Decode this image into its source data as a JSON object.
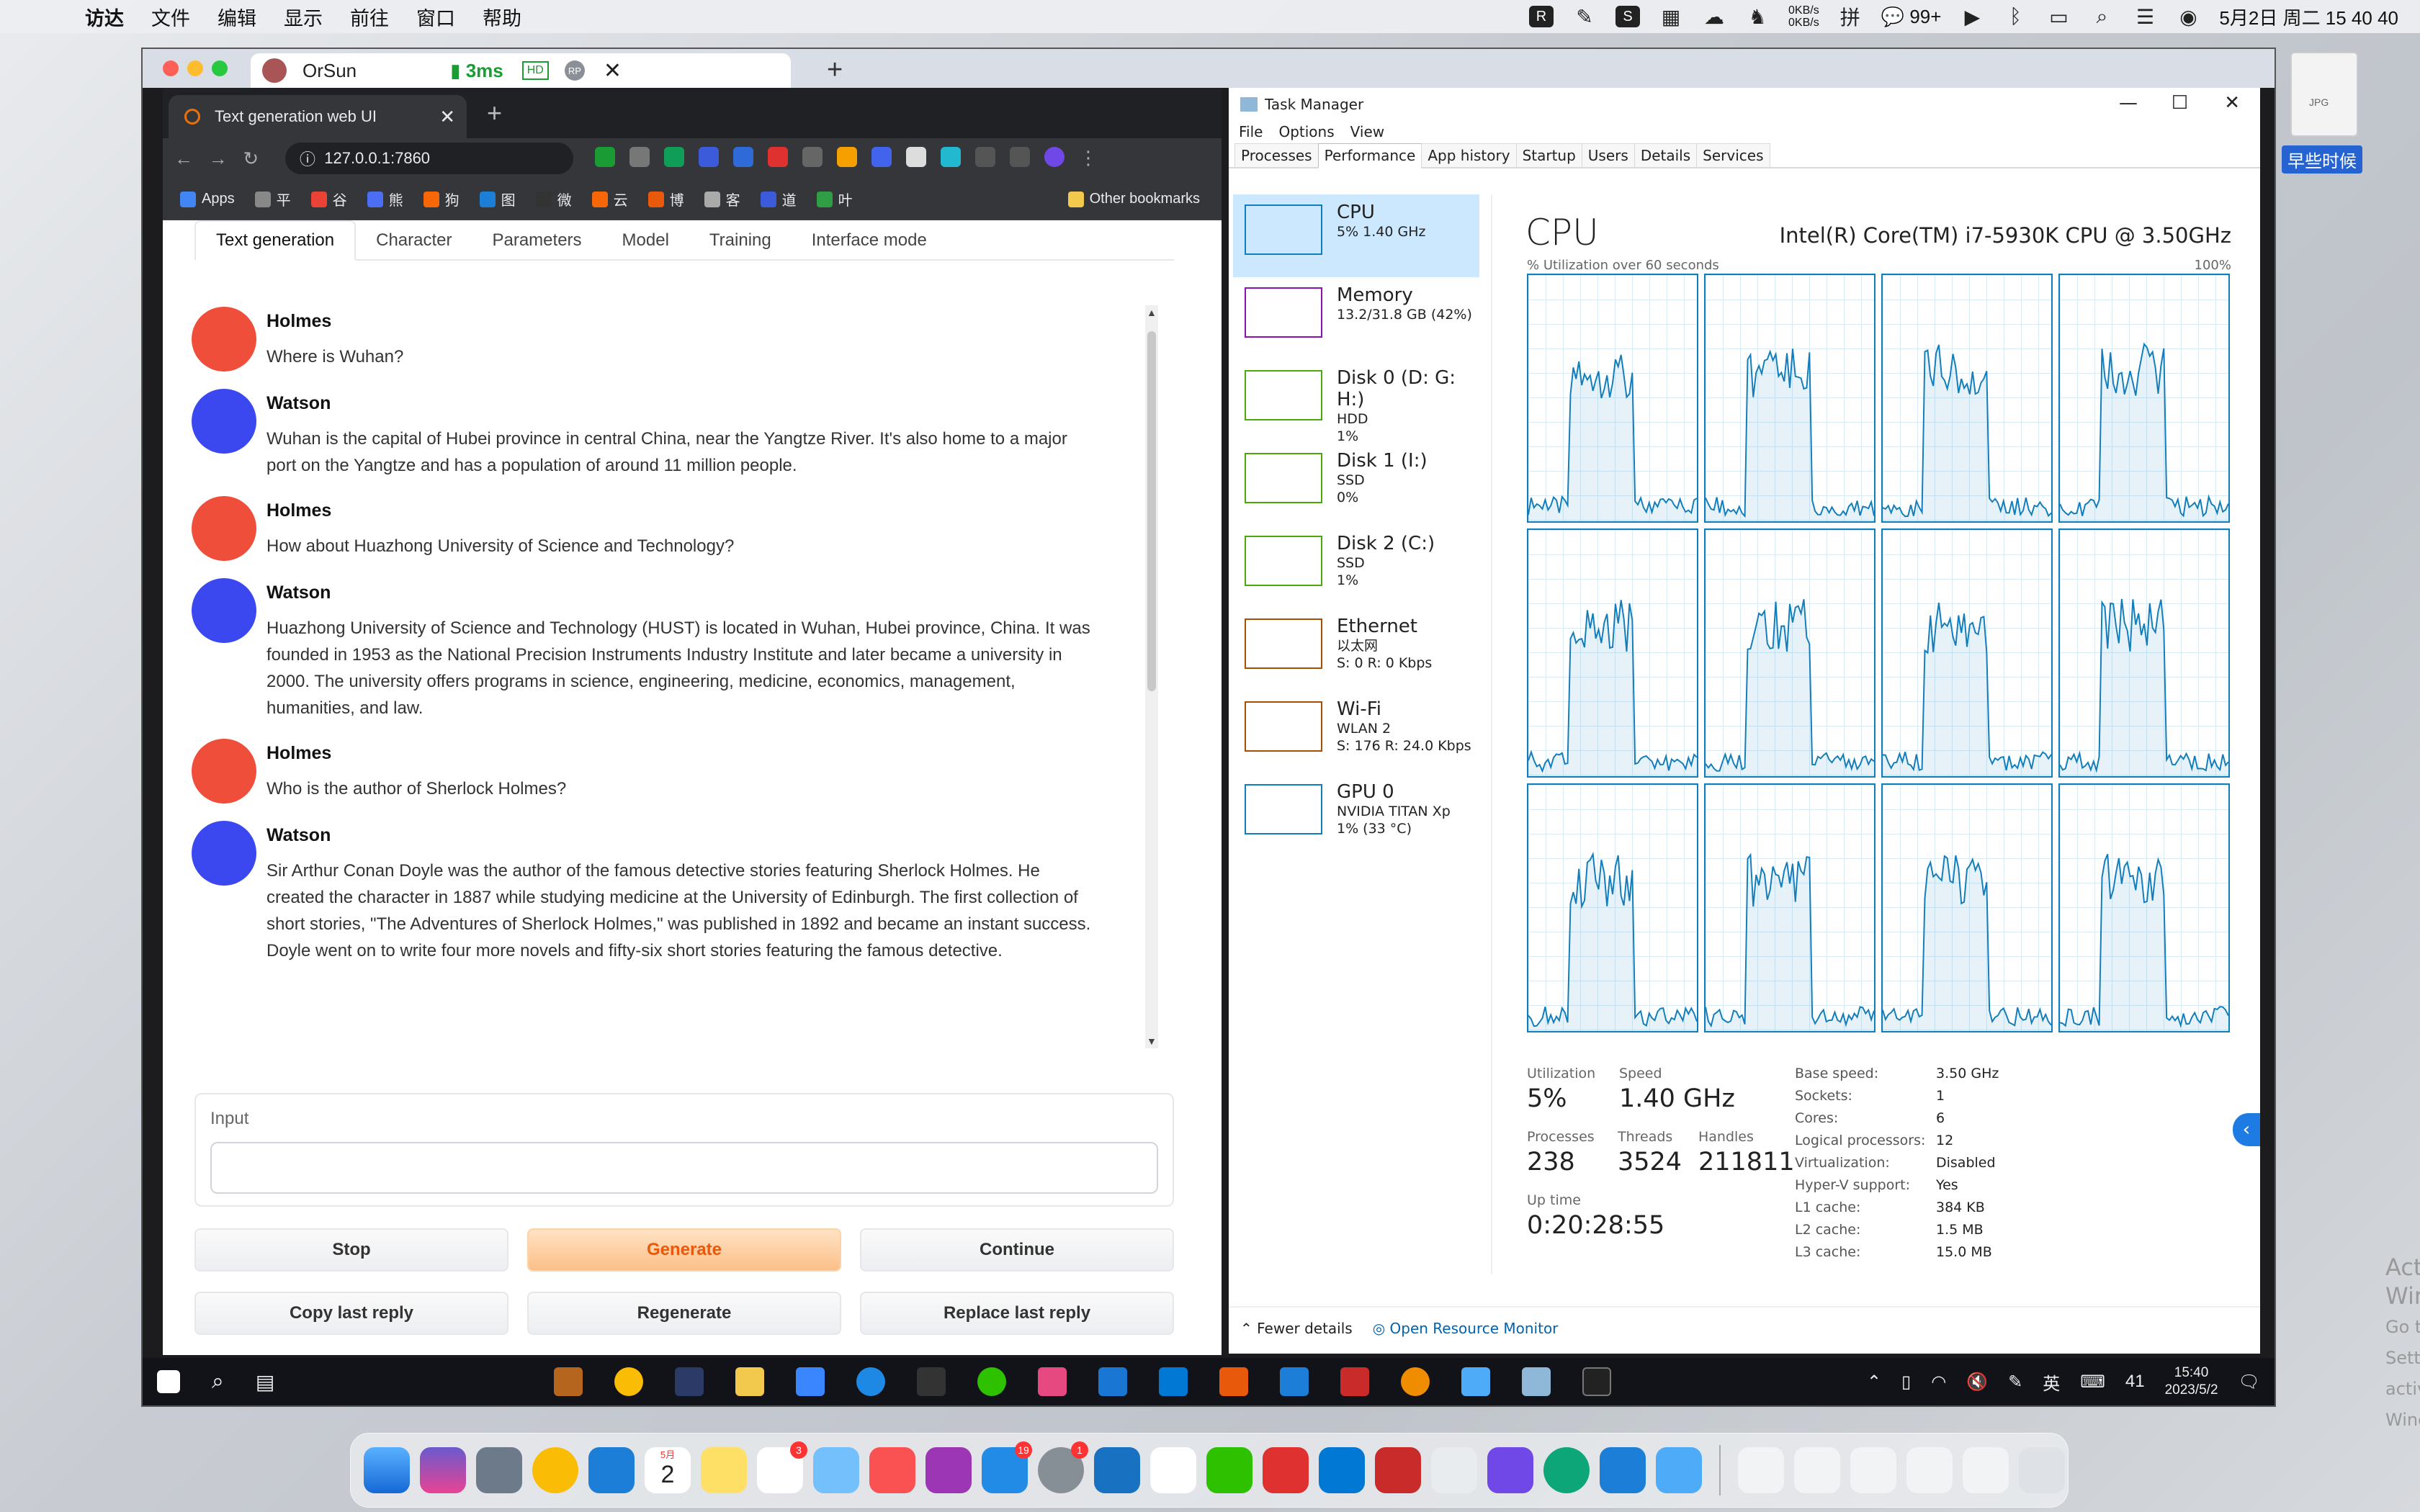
{
  "menubar": {
    "app": "访达",
    "items": [
      "文件",
      "编辑",
      "显示",
      "前往",
      "窗口",
      "帮助"
    ],
    "net_up": "0KB/s",
    "net_down": "0KB/s",
    "wechat_count": "99+",
    "datetime": "5月2日 周二  15 40 40"
  },
  "remote": {
    "tab_title": "OrSun",
    "latency": "3ms",
    "hd_badge": "HD",
    "rp_badge": "RP"
  },
  "browser": {
    "tab_title": "Text generation web UI",
    "url": "127.0.0.1:7860",
    "bookmarks": [
      "Apps",
      "平",
      "谷",
      "熊",
      "狗",
      "图",
      "微",
      "云",
      "博",
      "客",
      "道",
      "叶"
    ],
    "other_bookmarks": "Other bookmarks"
  },
  "webui": {
    "tabs": [
      "Text generation",
      "Character",
      "Parameters",
      "Model",
      "Training",
      "Interface mode"
    ],
    "messages": [
      {
        "speaker": "Holmes",
        "text": "Where is Wuhan?"
      },
      {
        "speaker": "Watson",
        "text": "Wuhan is the capital of Hubei province in central China, near the Yangtze River. It's also home to a major port on the Yangtze and has a population of around 11 million people."
      },
      {
        "speaker": "Holmes",
        "text": "How about Huazhong University of Science and Technology?"
      },
      {
        "speaker": "Watson",
        "text": "Huazhong University of Science and Technology (HUST) is located in Wuhan, Hubei province, China. It was founded in 1953 as the National Precision Instruments Industry Institute and later became a university in 2000. The university offers programs in science, engineering, medicine, economics, management, humanities, and law."
      },
      {
        "speaker": "Holmes",
        "text": "Who is the author of Sherlock Holmes?"
      },
      {
        "speaker": "Watson",
        "text": "Sir Arthur Conan Doyle was the author of the famous detective stories featuring Sherlock Holmes. He created the character in 1887 while studying medicine at the University of Edinburgh. The first collection of short stories, \"The Adventures of Sherlock Holmes,\" was published in 1892 and became an instant success. Doyle went on to write four more novels and fifty-six short stories featuring the famous detective."
      }
    ],
    "colors": {
      "holmes": "#ef4e3b",
      "watson": "#3b48f0"
    },
    "input_label": "Input",
    "input_value": "",
    "buttons": {
      "stop": "Stop",
      "generate": "Generate",
      "continue": "Continue",
      "copy_last": "Copy last reply",
      "regenerate": "Regenerate",
      "replace_last": "Replace last reply"
    }
  },
  "taskmgr": {
    "title": "Task Manager",
    "menu": [
      "File",
      "Options",
      "View"
    ],
    "tabs": [
      "Processes",
      "Performance",
      "App history",
      "Startup",
      "Users",
      "Details",
      "Services"
    ],
    "side": [
      {
        "name": "CPU",
        "s1": "5%  1.40 GHz",
        "s2": "",
        "color": "#117dbb"
      },
      {
        "name": "Memory",
        "s1": "13.2/31.8 GB (42%)",
        "s2": "",
        "color": "#8b12ae"
      },
      {
        "name": "Disk 0 (D: G: H:)",
        "s1": "HDD",
        "s2": "1%",
        "color": "#4da60c"
      },
      {
        "name": "Disk 1 (I:)",
        "s1": "SSD",
        "s2": "0%",
        "color": "#4da60c"
      },
      {
        "name": "Disk 2 (C:)",
        "s1": "SSD",
        "s2": "1%",
        "color": "#4da60c"
      },
      {
        "name": "Ethernet",
        "s1": "以太网",
        "s2": "S: 0  R: 0 Kbps",
        "color": "#a74f01"
      },
      {
        "name": "Wi-Fi",
        "s1": "WLAN 2",
        "s2": "S: 176  R: 24.0 Kbps",
        "color": "#a74f01"
      },
      {
        "name": "GPU 0",
        "s1": "NVIDIA TITAN Xp",
        "s2": "1% (33 °C)",
        "color": "#117dbb"
      }
    ],
    "cpu_title": "CPU",
    "cpu_model": "Intel(R) Core(TM) i7-5930K CPU @ 3.50GHz",
    "util_label": "% Utilization over 60 seconds",
    "util_max": "100%",
    "stats": {
      "utilization_label": "Utilization",
      "utilization": "5%",
      "speed_label": "Speed",
      "speed": "1.40 GHz",
      "processes_label": "Processes",
      "processes": "238",
      "threads_label": "Threads",
      "threads": "3524",
      "handles_label": "Handles",
      "handles": "211811",
      "uptime_label": "Up time",
      "uptime": "0:20:28:55"
    },
    "specs": [
      {
        "k": "Base speed:",
        "v": "3.50 GHz"
      },
      {
        "k": "Sockets:",
        "v": "1"
      },
      {
        "k": "Cores:",
        "v": "6"
      },
      {
        "k": "Logical processors:",
        "v": "12"
      },
      {
        "k": "Virtualization:",
        "v": "Disabled"
      },
      {
        "k": "Hyper-V support:",
        "v": "Yes"
      },
      {
        "k": "L1 cache:",
        "v": "384 KB"
      },
      {
        "k": "L2 cache:",
        "v": "1.5 MB"
      },
      {
        "k": "L3 cache:",
        "v": "15.0 MB"
      }
    ],
    "fewer_details": "Fewer details",
    "resource_monitor": "Open Resource Monitor",
    "activate_1": "Activate Windows",
    "activate_2": "Go to Settings to activate Windows."
  },
  "win_taskbar": {
    "time": "15:40",
    "date": "2023/5/2",
    "lang": "英",
    "notif": "41"
  },
  "desktop": {
    "icon_label": "早些时候",
    "file_type": "JPG"
  },
  "dock": {
    "calendar_month": "5月",
    "calendar_day": "2",
    "reminders_badge": "3",
    "appstore_badge": "19",
    "settings_badge": "1"
  }
}
